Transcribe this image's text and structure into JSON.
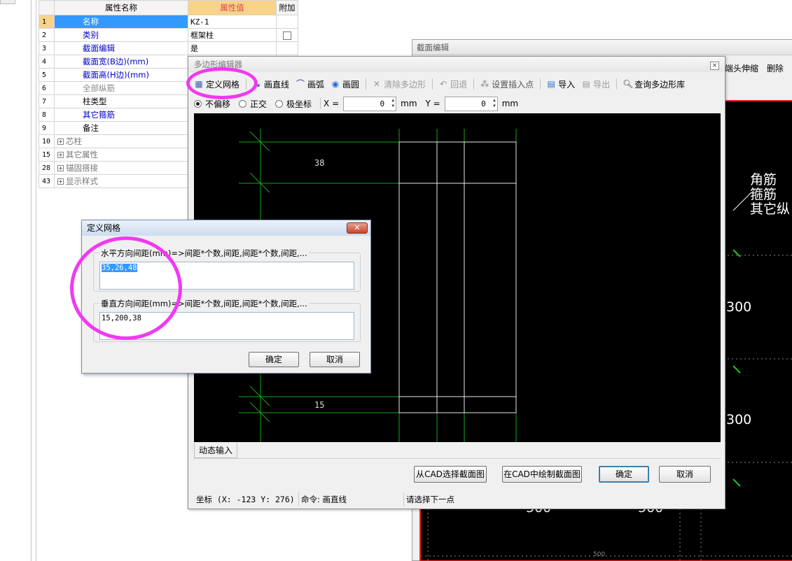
{
  "property_grid": {
    "header_name": "属性名称",
    "header_value": "属性值",
    "header_extra": "附加",
    "rows": [
      {
        "num": "1",
        "name": "名称",
        "value": "KZ-1"
      },
      {
        "num": "2",
        "name": "类别",
        "value": "框架柱"
      },
      {
        "num": "3",
        "name": "截面编辑",
        "value": "是"
      },
      {
        "num": "4",
        "name": "截面宽(B边)(mm)",
        "value": ""
      },
      {
        "num": "5",
        "name": "截面高(H边)(mm)",
        "value": ""
      },
      {
        "num": "6",
        "name": "全部纵筋",
        "value": ""
      },
      {
        "num": "7",
        "name": "柱类型",
        "value": ""
      },
      {
        "num": "8",
        "name": "其它箍筋",
        "value": ""
      },
      {
        "num": "9",
        "name": "备注",
        "value": ""
      },
      {
        "num": "10",
        "name": "芯柱",
        "value": ""
      },
      {
        "num": "15",
        "name": "其它属性",
        "value": ""
      },
      {
        "num": "28",
        "name": "锚固搭接",
        "value": ""
      },
      {
        "num": "43",
        "name": "显示样式",
        "value": ""
      }
    ]
  },
  "section_editor": {
    "title": "截面编辑",
    "toolbar": [
      "端头伸缩",
      "删除"
    ],
    "legend": [
      "角筋",
      "箍筋",
      "其它纵"
    ],
    "dims": [
      "300",
      "300",
      "500",
      "500",
      "500"
    ]
  },
  "polygon_editor": {
    "title": "多边形编辑器",
    "toolbar": {
      "define_grid": "定义网格",
      "draw_line": "画直线",
      "draw_arc": "画弧",
      "draw_circle": "画圆",
      "clear_polygon": "清除多边形",
      "undo": "回退",
      "set_insert_point": "设置插入点",
      "import": "导入",
      "export": "导出",
      "query_library": "查询多边形库"
    },
    "options": {
      "no_offset": "不偏移",
      "orthogonal": "正交",
      "polar": "极坐标",
      "x_label": "X =",
      "x_value": "0",
      "y_label": "Y =",
      "y_value": "0",
      "unit": "mm"
    },
    "canvas_labels": [
      "38",
      "15"
    ],
    "dynamic_input_tab": "动态输入",
    "buttons": {
      "from_cad": "从CAD选择截面图",
      "draw_in_cad": "在CAD中绘制截面图",
      "ok": "确定",
      "cancel": "取消"
    },
    "status": {
      "coords": "坐标 (X: -123 Y: 276)",
      "command": "命令: 画直线",
      "prompt": "请选择下一点"
    }
  },
  "grid_dialog": {
    "title": "定义网格",
    "horizontal_label": "水平方向间距(mm)=>间距*个数,间距,间距*个数,间距,...",
    "horizontal_value": "35,26,48",
    "vertical_label": "垂直方向间距(mm)=>间距*个数,间距,间距*个数,间距,...",
    "vertical_value": "15,200,38",
    "ok": "确定",
    "cancel": "取消"
  },
  "colors": {
    "highlight_ring": "#f238f2",
    "selection": "#3399ff",
    "grid_line": "#19a319",
    "section_border": "#ff2020"
  }
}
